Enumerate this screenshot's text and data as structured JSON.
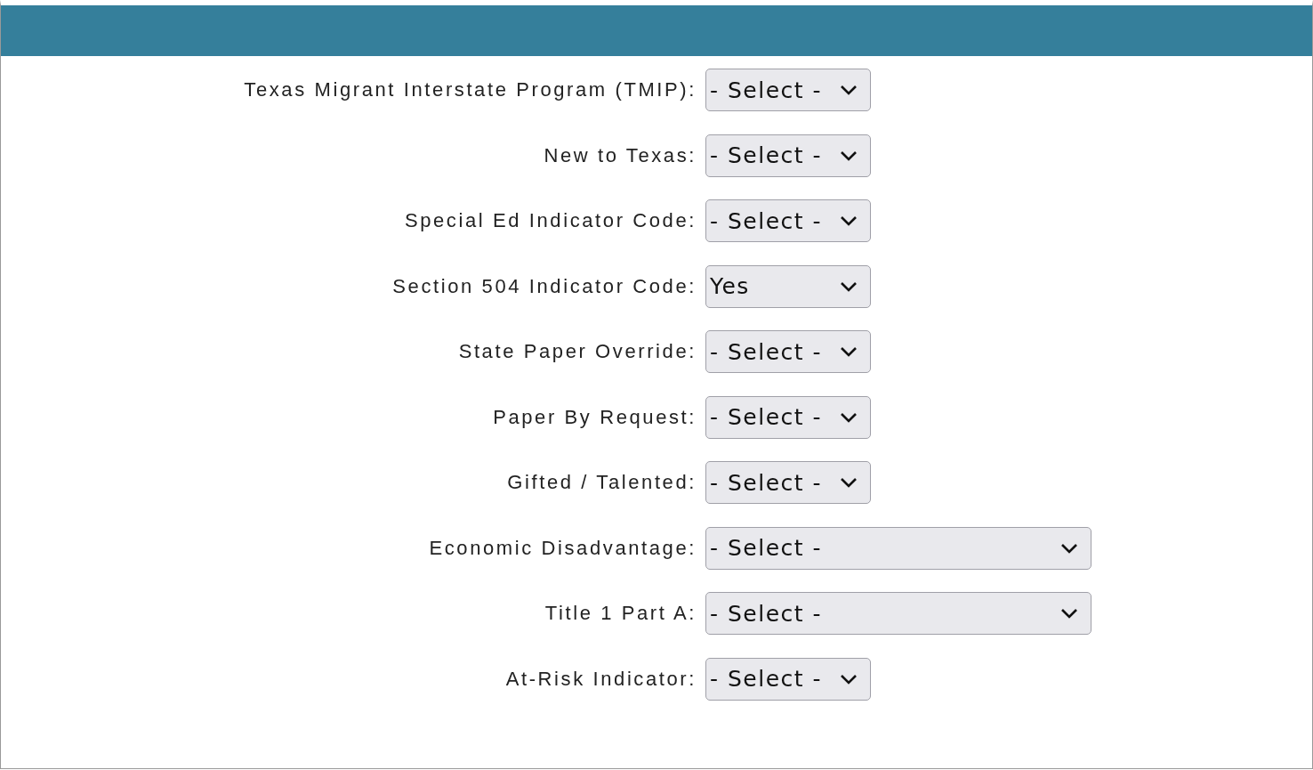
{
  "fields": [
    {
      "label": "Texas Migrant Interstate Program (TMIP):",
      "value": "- Select -",
      "kind": "narrow"
    },
    {
      "label": "New to Texas:",
      "value": "- Select -",
      "kind": "narrow"
    },
    {
      "label": "Special Ed Indicator Code:",
      "value": "- Select -",
      "kind": "narrow"
    },
    {
      "label": "Section 504 Indicator Code:",
      "value": "Yes",
      "kind": "narrow"
    },
    {
      "label": "State Paper Override:",
      "value": "- Select -",
      "kind": "narrow"
    },
    {
      "label": "Paper By Request:",
      "value": "- Select -",
      "kind": "narrow"
    },
    {
      "label": "Gifted / Talented:",
      "value": "- Select -",
      "kind": "narrow"
    },
    {
      "label": "Economic Disadvantage:",
      "value": "- Select -",
      "kind": "wide"
    },
    {
      "label": "Title 1 Part A:",
      "value": "- Select -",
      "kind": "wide"
    },
    {
      "label": "At-Risk Indicator:",
      "value": "- Select -",
      "kind": "narrow"
    }
  ]
}
